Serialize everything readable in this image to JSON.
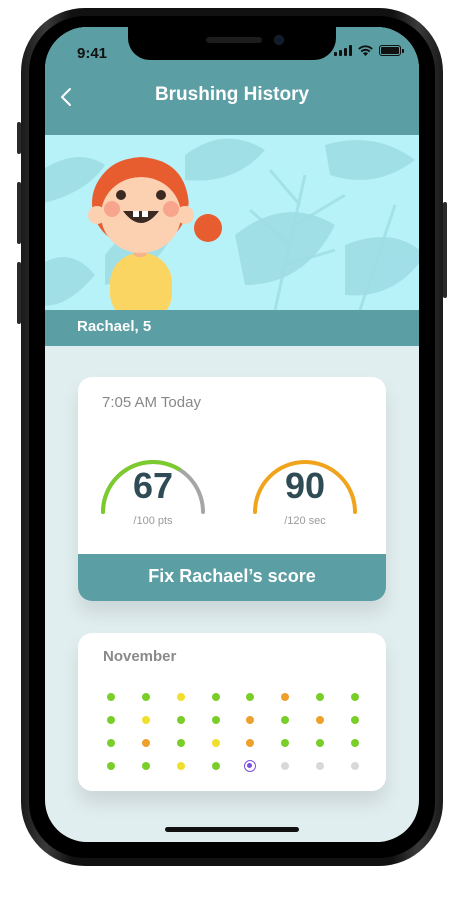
{
  "status": {
    "time": "9:41"
  },
  "header": {
    "title": "Brushing History"
  },
  "profile": {
    "name": "Rachael, 5"
  },
  "session": {
    "time_label": "7:05 AM Today",
    "score": {
      "value": "67",
      "unit": "/100 pts",
      "fraction": 0.67
    },
    "duration": {
      "value": "90",
      "unit": "/120 sec",
      "fraction": 0.75
    },
    "fix_button_label": "Fix Rachael’s score"
  },
  "calendar": {
    "month": "November",
    "rows": [
      [
        "green",
        "green",
        "yellow",
        "green",
        "green",
        "orange",
        "green",
        "green"
      ],
      [
        "green",
        "yellow",
        "green",
        "green",
        "orange",
        "green",
        "orange",
        "green"
      ],
      [
        "green",
        "orange",
        "green",
        "yellow",
        "orange",
        "green",
        "green",
        "green"
      ],
      [
        "green",
        "green",
        "yellow",
        "green",
        "selected",
        "gray",
        "gray",
        "gray"
      ]
    ]
  },
  "colors": {
    "teal": "#5b9ea3",
    "score_arc": "#7acb2b",
    "duration_arc": "#f0a41c",
    "green": "#7ace2a",
    "yellow": "#f1e02b",
    "orange": "#eda12a",
    "gray": "#d8d8d8",
    "selected": "#7b4fe0"
  }
}
